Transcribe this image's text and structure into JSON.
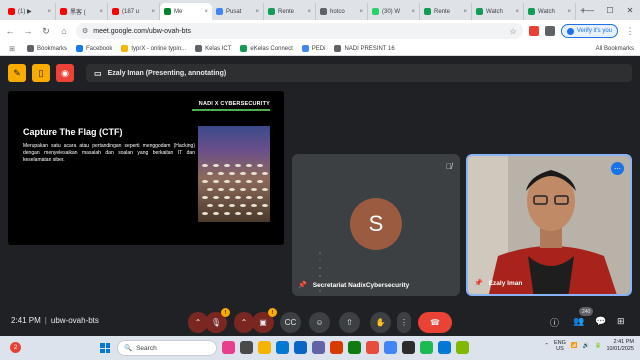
{
  "browser": {
    "tabs": [
      {
        "label": "(1) ▶",
        "color": "#ff0000"
      },
      {
        "label": "黑客 (",
        "color": "#ff0000"
      },
      {
        "label": "(187 u",
        "color": "#ff0000"
      },
      {
        "label": "Me",
        "color": "#00832d",
        "active": true
      },
      {
        "label": "Pusat",
        "color": "#4285f4"
      },
      {
        "label": "Rente",
        "color": "#0f9d58"
      },
      {
        "label": "hotco",
        "color": "#5f6368"
      },
      {
        "label": "(30) W",
        "color": "#25d366"
      },
      {
        "label": "Rente",
        "color": "#0f9d58"
      },
      {
        "label": "Watch",
        "color": "#0f9d58"
      },
      {
        "label": "Watch",
        "color": "#0f9d58"
      }
    ],
    "url": "meet.google.com/ubw-ovah-bts",
    "verify_label": "Verify it's you",
    "bookmarks": [
      {
        "label": "Bookmarks",
        "color": "#5f6368"
      },
      {
        "label": "Facebook",
        "color": "#1877f2"
      },
      {
        "label": "typrX - online typin...",
        "color": "#f4b400"
      },
      {
        "label": "Kelas ICT",
        "color": "#5f6368"
      },
      {
        "label": "eKelas Connect",
        "color": "#0f9d58"
      },
      {
        "label": "PEDi",
        "color": "#4285f4"
      },
      {
        "label": "NADI PRESINT 16",
        "color": "#5f6368"
      }
    ],
    "all_bookmarks": "All Bookmarks"
  },
  "meet": {
    "presenting_label": "Ezaly Iman (Presenting, annotating)",
    "slide": {
      "brand": "NADI X CYBERSECURITY",
      "title": "Capture The Flag (CTF)",
      "body": "Merupakan satu acara atau pertandingan seperti menggodam (Hacking) dengan menyelesaikan masalah dan soalan yang berkaitan IT dan keselamatan siber."
    },
    "participants": [
      {
        "name": "Secretariat NadixCybersecurity",
        "initial": "S"
      },
      {
        "name": "Ezaly Iman"
      }
    ],
    "time": "2:41 PM",
    "meeting_code": "ubw-ovah-bts",
    "participant_count": "240",
    "alert_badge": "!",
    "colors": {
      "accent": "#8ab4f8",
      "end_call": "#ea4335",
      "muted": "#7a2722"
    }
  },
  "taskbar": {
    "notification_count": "2",
    "search_placeholder": "Search",
    "lang_top": "ENG",
    "lang_bottom": "US",
    "time": "2:41 PM",
    "date": "10/01/2025"
  }
}
